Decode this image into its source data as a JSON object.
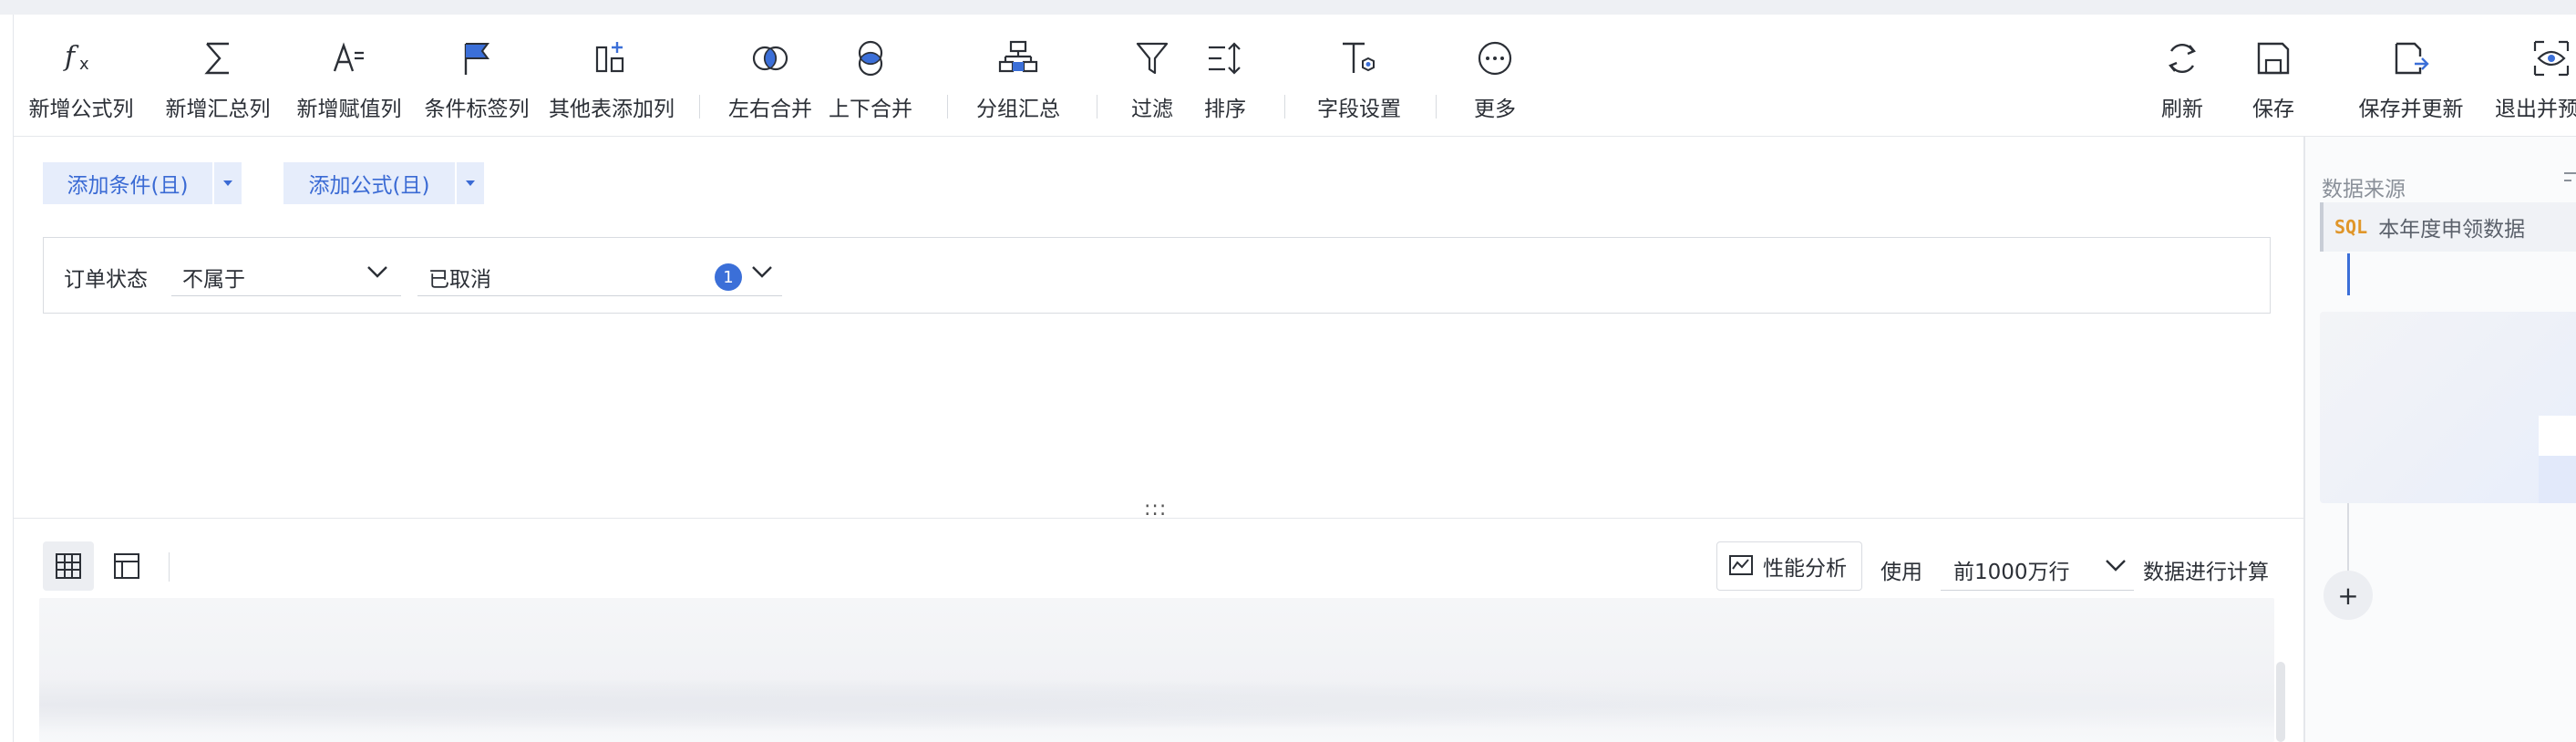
{
  "toolbar": {
    "add_formula_col": "新增公式列",
    "add_summary_col": "新增汇总列",
    "add_assign_col": "新增赋值列",
    "add_cond_tag_col": "条件标签列",
    "add_other_table_col": "其他表添加列",
    "merge_lr": "左右合并",
    "merge_tb": "上下合并",
    "group_summary": "分组汇总",
    "filter": "过滤",
    "sort": "排序",
    "field_settings": "字段设置",
    "more": "更多",
    "refresh": "刷新",
    "save": "保存",
    "save_update": "保存并更新",
    "exit_preview": "退出并预"
  },
  "filter": {
    "add_condition": "添加条件(且)",
    "add_formula": "添加公式(且)",
    "field_label": "订单状态",
    "operator": "不属于",
    "value": "已取消",
    "value_count": "1"
  },
  "drag_handle": ":::",
  "bottom": {
    "perf_analysis": "性能分析",
    "use_label": "使用",
    "rows_option": "前1000万行",
    "compute_label": "数据进行计算"
  },
  "right_panel": {
    "title": "数据来源",
    "source_type": "SQL",
    "source_name": "本年度申领数据",
    "add": "+"
  },
  "colors": {
    "accent": "#3b6fd8",
    "button_bg": "#e6edfb",
    "sql_tag": "#e0962a"
  }
}
